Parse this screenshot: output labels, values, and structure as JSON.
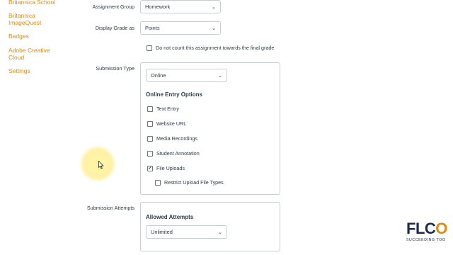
{
  "sidebar": {
    "items": [
      {
        "label": "Britannica School"
      },
      {
        "label": "Britannica ImageQuest"
      },
      {
        "label": "Badges"
      },
      {
        "label": "Adobe Creative Cloud"
      },
      {
        "label": "Settings"
      }
    ]
  },
  "form": {
    "assignment_group": {
      "label": "Assignment Group",
      "value": "Homework"
    },
    "display_grade": {
      "label": "Display Grade as",
      "value": "Points"
    },
    "do_not_count": {
      "label": "Do not count this assignment towards the final grade",
      "checked": false
    },
    "submission_type": {
      "label": "Submission Type",
      "value": "Online",
      "options_heading": "Online Entry Options",
      "options": [
        {
          "label": "Text Entry",
          "checked": false
        },
        {
          "label": "Website URL",
          "checked": false
        },
        {
          "label": "Media Recordings",
          "checked": false
        },
        {
          "label": "Student Annotation",
          "checked": false
        },
        {
          "label": "File Uploads",
          "checked": true
        }
      ],
      "restrict": {
        "label": "Restrict Upload File Types",
        "checked": false
      }
    },
    "submission_attempts": {
      "label": "Submission Attempts",
      "heading": "Allowed Attempts",
      "value": "Unlimited"
    }
  },
  "logo": {
    "mark_left": "FLC",
    "mark_right": "O",
    "tagline": "SUCCEEDING TOG"
  },
  "colors": {
    "link": "#e08a10",
    "text": "#2d3b45",
    "border": "#c7cdd1",
    "logo_navy": "#1a2a55"
  }
}
